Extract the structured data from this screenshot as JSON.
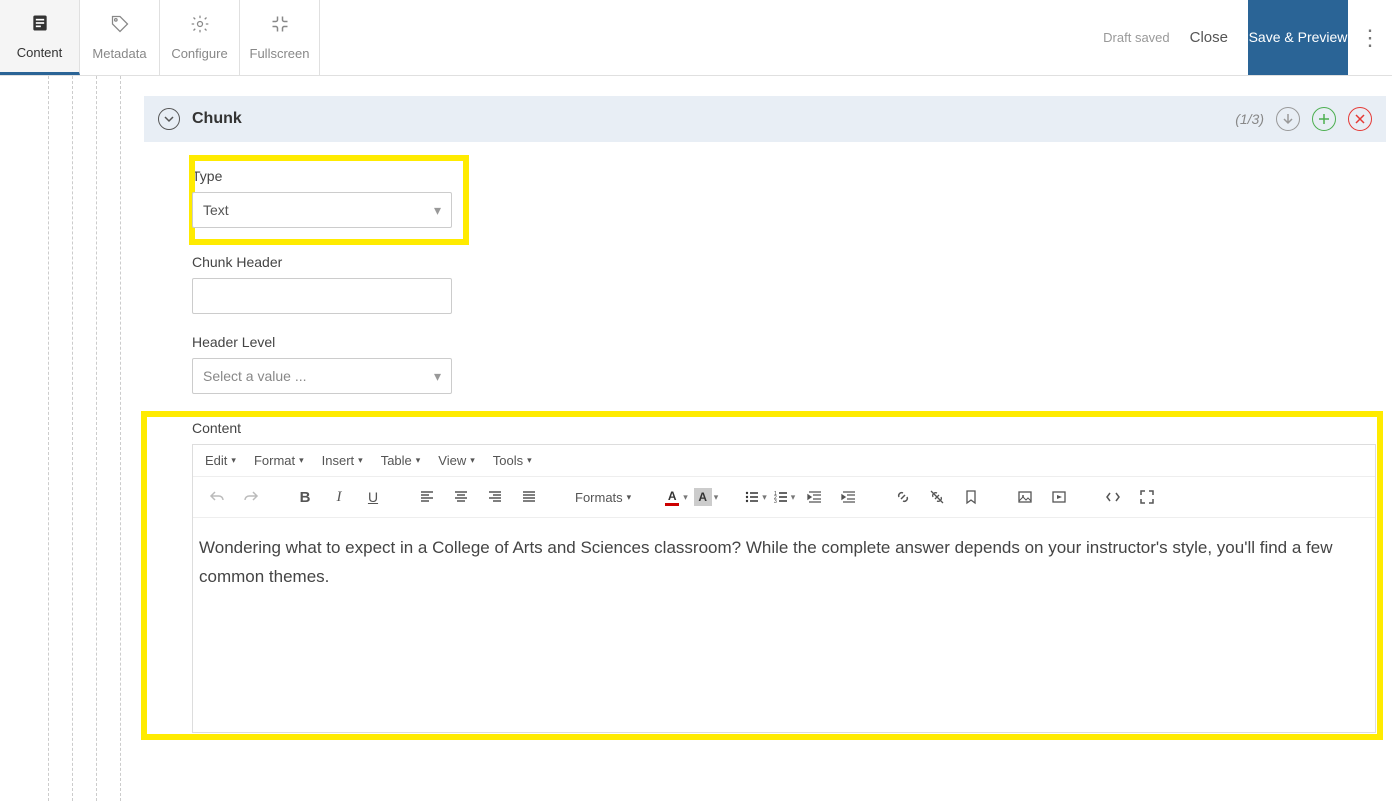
{
  "topbar": {
    "tabs": {
      "content": "Content",
      "metadata": "Metadata",
      "configure": "Configure",
      "fullscreen": "Fullscreen"
    },
    "draft_status": "Draft saved",
    "close": "Close",
    "save": "Save & Preview"
  },
  "chunk": {
    "title": "Chunk",
    "count": "(1/3)"
  },
  "fields": {
    "type_label": "Type",
    "type_value": "Text",
    "chunk_header_label": "Chunk Header",
    "chunk_header_value": "",
    "header_level_label": "Header Level",
    "header_level_placeholder": "Select a value ...",
    "content_label": "Content"
  },
  "editor": {
    "menu": {
      "edit": "Edit",
      "format": "Format",
      "insert": "Insert",
      "table": "Table",
      "view": "View",
      "tools": "Tools"
    },
    "formats_label": "Formats",
    "body_text": "Wondering what to expect in a College of Arts and Sciences classroom? While the complete answer depends on your instructor's style, you'll find a few common themes."
  }
}
